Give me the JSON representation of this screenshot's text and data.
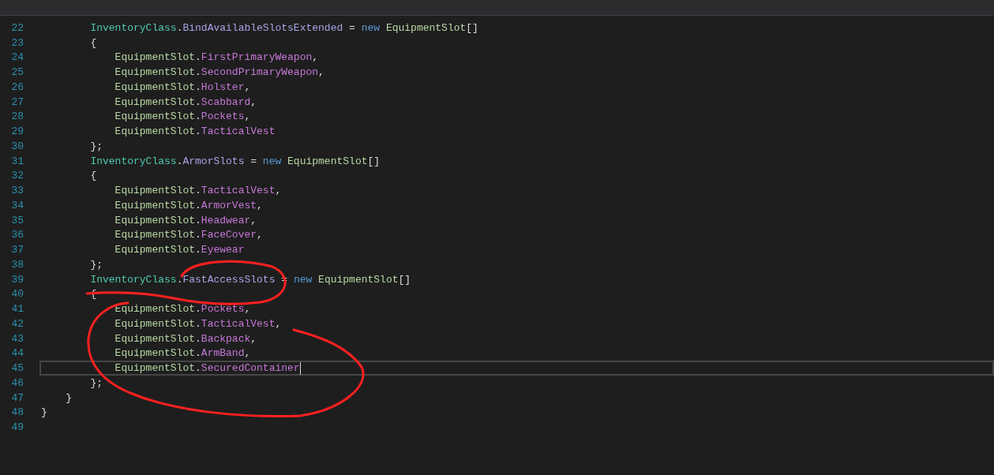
{
  "editor": {
    "lines": [
      {
        "children": [
          {
            "children": [
              {
                "number": "22",
                "current": false,
                "tokens": [
                  {
                    "kind": "class",
                    "text": "InventoryClass"
                  },
                  {
                    "kind": "punct",
                    "text": "."
                  },
                  {
                    "kind": "member",
                    "text": "BindAvailableSlotsExtended"
                  },
                  {
                    "kind": "punct",
                    "text": " = "
                  },
                  {
                    "kind": "keyword",
                    "text": "new"
                  },
                  {
                    "kind": "type",
                    "text": "EquipmentSlot"
                  },
                  {
                    "kind": "punct",
                    "text": "[]"
                  }
                ]
              },
              {
                "number": "23",
                "current": false,
                "tokens": [
                  {
                    "kind": "punct",
                    "text": "{"
                  }
                ]
              },
              {
                "children": [
                  {
                    "number": "24",
                    "current": false,
                    "tokens": [
                      {
                        "kind": "type",
                        "text": "EquipmentSlot"
                      },
                      {
                        "kind": "punct",
                        "text": "."
                      },
                      {
                        "kind": "enum",
                        "text": "FirstPrimaryWeapon"
                      },
                      {
                        "kind": "punct",
                        "text": ","
                      }
                    ]
                  },
                  {
                    "number": "25",
                    "current": false,
                    "tokens": [
                      {
                        "kind": "type",
                        "text": "EquipmentSlot"
                      },
                      {
                        "kind": "punct",
                        "text": "."
                      },
                      {
                        "kind": "enum",
                        "text": "SecondPrimaryWeapon"
                      },
                      {
                        "kind": "punct",
                        "text": ","
                      }
                    ]
                  },
                  {
                    "number": "26",
                    "current": false,
                    "tokens": [
                      {
                        "kind": "type",
                        "text": "EquipmentSlot"
                      },
                      {
                        "kind": "punct",
                        "text": "."
                      },
                      {
                        "kind": "enum",
                        "text": "Holster"
                      },
                      {
                        "kind": "punct",
                        "text": ","
                      }
                    ]
                  },
                  {
                    "number": "27",
                    "current": false,
                    "tokens": [
                      {
                        "kind": "type",
                        "text": "EquipmentSlot"
                      },
                      {
                        "kind": "punct",
                        "text": "."
                      },
                      {
                        "kind": "enum",
                        "text": "Scabbard"
                      },
                      {
                        "kind": "punct",
                        "text": ","
                      }
                    ]
                  },
                  {
                    "number": "28",
                    "current": false,
                    "tokens": [
                      {
                        "kind": "type",
                        "text": "EquipmentSlot"
                      },
                      {
                        "kind": "punct",
                        "text": "."
                      },
                      {
                        "kind": "enum",
                        "text": "Pockets"
                      },
                      {
                        "kind": "punct",
                        "text": ","
                      }
                    ]
                  },
                  {
                    "number": "29",
                    "current": false,
                    "tokens": [
                      {
                        "kind": "type",
                        "text": "EquipmentSlot"
                      },
                      {
                        "kind": "punct",
                        "text": "."
                      },
                      {
                        "kind": "enum",
                        "text": "TacticalVest"
                      }
                    ]
                  }
                ]
              },
              {
                "number": "30",
                "current": false,
                "tokens": [
                  {
                    "kind": "punct",
                    "text": "};"
                  }
                ]
              },
              {
                "number": "31",
                "current": false,
                "tokens": [
                  {
                    "kind": "class",
                    "text": "InventoryClass"
                  },
                  {
                    "kind": "punct",
                    "text": "."
                  },
                  {
                    "kind": "member",
                    "text": "ArmorSlots"
                  },
                  {
                    "kind": "punct",
                    "text": " = "
                  },
                  {
                    "kind": "keyword",
                    "text": "new"
                  },
                  {
                    "kind": "type",
                    "text": "EquipmentSlot"
                  },
                  {
                    "kind": "punct",
                    "text": "[]"
                  }
                ]
              },
              {
                "number": "32",
                "current": false,
                "tokens": [
                  {
                    "kind": "punct",
                    "text": "{"
                  }
                ]
              },
              {
                "children": [
                  {
                    "number": "33",
                    "current": false,
                    "tokens": [
                      {
                        "kind": "type",
                        "text": "EquipmentSlot"
                      },
                      {
                        "kind": "punct",
                        "text": "."
                      },
                      {
                        "kind": "enum",
                        "text": "TacticalVest"
                      },
                      {
                        "kind": "punct",
                        "text": ","
                      }
                    ]
                  },
                  {
                    "number": "34",
                    "current": false,
                    "tokens": [
                      {
                        "kind": "type",
                        "text": "EquipmentSlot"
                      },
                      {
                        "kind": "punct",
                        "text": "."
                      },
                      {
                        "kind": "enum",
                        "text": "ArmorVest"
                      },
                      {
                        "kind": "punct",
                        "text": ","
                      }
                    ]
                  },
                  {
                    "number": "35",
                    "current": false,
                    "tokens": [
                      {
                        "kind": "type",
                        "text": "EquipmentSlot"
                      },
                      {
                        "kind": "punct",
                        "text": "."
                      },
                      {
                        "kind": "enum",
                        "text": "Headwear"
                      },
                      {
                        "kind": "punct",
                        "text": ","
                      }
                    ]
                  },
                  {
                    "number": "36",
                    "current": false,
                    "tokens": [
                      {
                        "kind": "type",
                        "text": "EquipmentSlot"
                      },
                      {
                        "kind": "punct",
                        "text": "."
                      },
                      {
                        "kind": "enum",
                        "text": "FaceCover"
                      },
                      {
                        "kind": "punct",
                        "text": ","
                      }
                    ]
                  },
                  {
                    "number": "37",
                    "current": false,
                    "tokens": [
                      {
                        "kind": "type",
                        "text": "EquipmentSlot"
                      },
                      {
                        "kind": "punct",
                        "text": "."
                      },
                      {
                        "kind": "enum",
                        "text": "Eyewear"
                      }
                    ]
                  }
                ]
              },
              {
                "number": "38",
                "current": false,
                "tokens": [
                  {
                    "kind": "punct",
                    "text": "};"
                  }
                ]
              },
              {
                "number": "39",
                "current": false,
                "tokens": [
                  {
                    "kind": "class",
                    "text": "InventoryClass"
                  },
                  {
                    "kind": "punct",
                    "text": "."
                  },
                  {
                    "kind": "member",
                    "text": "FastAccessSlots"
                  },
                  {
                    "kind": "punct",
                    "text": " = "
                  },
                  {
                    "kind": "keyword",
                    "text": "new"
                  },
                  {
                    "kind": "type",
                    "text": "EquipmentSlot"
                  },
                  {
                    "kind": "punct",
                    "text": "[]"
                  }
                ]
              },
              {
                "number": "40",
                "current": false,
                "tokens": [
                  {
                    "kind": "punct",
                    "text": "{"
                  }
                ]
              },
              {
                "children": [
                  {
                    "number": "41",
                    "current": false,
                    "tokens": [
                      {
                        "kind": "type",
                        "text": "EquipmentSlot"
                      },
                      {
                        "kind": "punct",
                        "text": "."
                      },
                      {
                        "kind": "enum",
                        "text": "Pockets"
                      },
                      {
                        "kind": "punct",
                        "text": ","
                      }
                    ]
                  },
                  {
                    "number": "42",
                    "current": false,
                    "tokens": [
                      {
                        "kind": "type",
                        "text": "EquipmentSlot"
                      },
                      {
                        "kind": "punct",
                        "text": "."
                      },
                      {
                        "kind": "enum",
                        "text": "TacticalVest"
                      },
                      {
                        "kind": "punct",
                        "text": ","
                      }
                    ]
                  },
                  {
                    "number": "43",
                    "current": false,
                    "tokens": [
                      {
                        "kind": "type",
                        "text": "EquipmentSlot"
                      },
                      {
                        "kind": "punct",
                        "text": "."
                      },
                      {
                        "kind": "enum",
                        "text": "Backpack"
                      },
                      {
                        "kind": "punct",
                        "text": ","
                      }
                    ]
                  },
                  {
                    "number": "44",
                    "current": false,
                    "tokens": [
                      {
                        "kind": "type",
                        "text": "EquipmentSlot"
                      },
                      {
                        "kind": "punct",
                        "text": "."
                      },
                      {
                        "kind": "enum",
                        "text": "ArmBand"
                      },
                      {
                        "kind": "punct",
                        "text": ","
                      }
                    ]
                  },
                  {
                    "number": "45",
                    "current": true,
                    "tokens": [
                      {
                        "kind": "type",
                        "text": "EquipmentSlot"
                      },
                      {
                        "kind": "punct",
                        "text": "."
                      },
                      {
                        "kind": "enum",
                        "text": "SecuredContainer"
                      }
                    ]
                  }
                ]
              },
              {
                "number": "46",
                "current": false,
                "tokens": [
                  {
                    "kind": "punct",
                    "text": "};"
                  }
                ]
              }
            ]
          },
          {
            "number": "47",
            "current": false,
            "tokens": [
              {
                "kind": "punct",
                "text": "}"
              }
            ]
          }
        ]
      },
      {
        "number": "48",
        "current": false,
        "tokens": [
          {
            "kind": "punct",
            "text": "}"
          }
        ]
      },
      {
        "number": "49",
        "current": false
      }
    ]
  }
}
